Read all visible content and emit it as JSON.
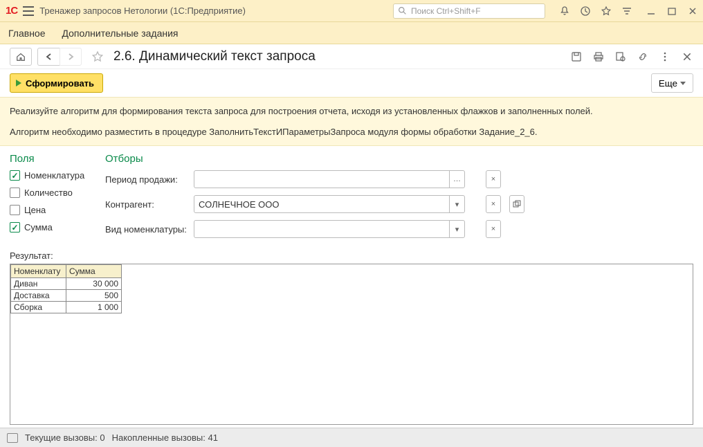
{
  "titlebar": {
    "app_title": "Тренажер запросов Нетологии  (1С:Предприятие)",
    "search_placeholder": "Поиск Ctrl+Shift+F"
  },
  "menubar": {
    "main": "Главное",
    "extra": "Дополнительные задания"
  },
  "page": {
    "title": "2.6. Динамический текст запроса"
  },
  "actions": {
    "form": "Сформировать",
    "more": "Еще"
  },
  "instructions": {
    "line1": "Реализуйте алгоритм для формирования текста запроса для построения отчета, исходя из установленных флажков и заполненных полей.",
    "line2": "Алгоритм необходимо разместить в процедуре ЗаполнитьТекстИПараметрыЗапроса модуля формы обработки Задание_2_6."
  },
  "fields": {
    "header": "Поля",
    "items": [
      {
        "label": "Номенклатура",
        "checked": true
      },
      {
        "label": "Количество",
        "checked": false
      },
      {
        "label": "Цена",
        "checked": false
      },
      {
        "label": "Сумма",
        "checked": true
      }
    ]
  },
  "filters": {
    "header": "Отборы",
    "period_label": "Период продажи:",
    "period_value": "",
    "counterparty_label": "Контрагент:",
    "counterparty_value": "СОЛНЕЧНОЕ ООО",
    "nomenclature_type_label": "Вид номенклатуры:",
    "nomenclature_type_value": ""
  },
  "result": {
    "label": "Результат:",
    "columns": [
      "Номенклатура",
      "Сумма"
    ],
    "rows": [
      {
        "name": "Диван",
        "sum": "30 000"
      },
      {
        "name": "Доставка",
        "sum": "500"
      },
      {
        "name": "Сборка",
        "sum": "1 000"
      }
    ]
  },
  "statusbar": {
    "current_calls_label": "Текущие вызовы:",
    "current_calls_value": "0",
    "accumulated_calls_label": "Накопленные вызовы:",
    "accumulated_calls_value": "41"
  },
  "chart_data": {
    "type": "table",
    "columns": [
      "Номенклатура",
      "Сумма"
    ],
    "rows": [
      [
        "Диван",
        30000
      ],
      [
        "Доставка",
        500
      ],
      [
        "Сборка",
        1000
      ]
    ]
  }
}
